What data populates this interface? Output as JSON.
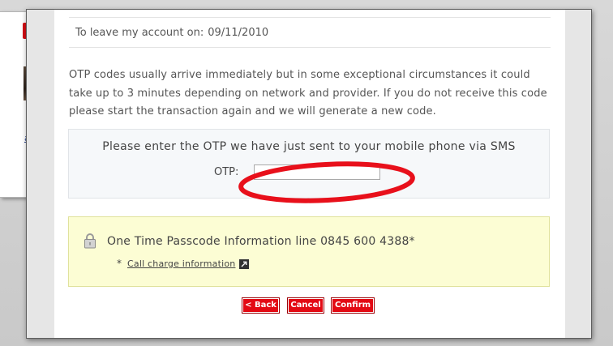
{
  "background": {
    "left_link_fragment": "age"
  },
  "account": {
    "leave_label": "To leave my account on:",
    "leave_date": "09/11/2010"
  },
  "notice_text": "OTP codes usually arrive immediately but in some exceptional circumstances it could take up to 3 minutes depending on network and provider. If you do not receive this code please start the transaction again and we will generate a new code.",
  "otp": {
    "prompt": "Please enter the OTP we have just sent to your mobile phone via SMS",
    "label": "OTP:",
    "value": ""
  },
  "info": {
    "line": "One Time Passcode Information line 0845 600 4388*",
    "footnote_marker": "*",
    "link_text": "Call charge information"
  },
  "buttons": {
    "back": "< Back",
    "cancel": "Cancel",
    "confirm": "Confirm"
  },
  "colors": {
    "accent_red": "#e30a14",
    "annotation_red": "#e8101b",
    "info_background": "#fcfdd4"
  },
  "icons": {
    "lock": "padlock-icon",
    "external_link": "external-link-icon"
  }
}
